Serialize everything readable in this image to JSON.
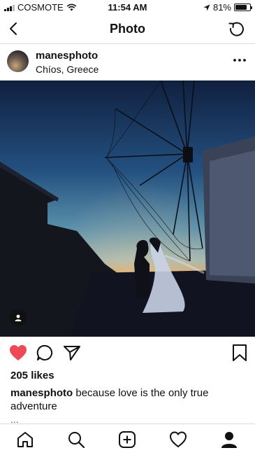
{
  "status_bar": {
    "carrier": "COSMOTE",
    "time": "11:54 AM",
    "battery_percent": "81%",
    "battery_level": 0.81,
    "icons": [
      "signal-icon",
      "wifi-icon",
      "location-arrow-icon",
      "battery-icon"
    ]
  },
  "nav": {
    "title": "Photo",
    "back_icon": "chevron-left-icon",
    "refresh_icon": "refresh-icon"
  },
  "post": {
    "username": "manesphoto",
    "location": "Chíos, Greece",
    "more_icon": "more-horizontal-icon",
    "image_alt": "Silhouette of a couple at sunset beside a windmill",
    "likes": "205 likes",
    "caption_user": "manesphoto",
    "caption_text": " because love is the only true adventure",
    "caption_more": "..."
  },
  "actions": [
    "heart-filled-icon",
    "comment-icon",
    "share-icon",
    "bookmark-icon"
  ],
  "tab_bar": [
    "home-icon",
    "search-icon",
    "add-icon",
    "activity-heart-icon",
    "profile-icon"
  ],
  "colors": {
    "like_red": "#ed4956",
    "border": "#dbdbdb",
    "text": "#111111"
  }
}
